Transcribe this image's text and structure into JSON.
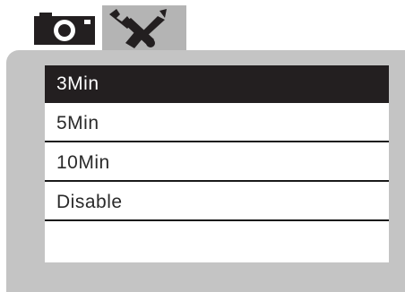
{
  "tabs": [
    {
      "icon": "camera-icon",
      "active": false
    },
    {
      "icon": "wrench-screwdriver-icon",
      "active": true
    }
  ],
  "menu": {
    "items": [
      {
        "label": "3Min",
        "selected": true
      },
      {
        "label": "5Min",
        "selected": false
      },
      {
        "label": "10Min",
        "selected": false
      },
      {
        "label": "Disable",
        "selected": false
      }
    ]
  },
  "colors": {
    "panel": "#c4c4c4",
    "active_tab": "#b4b4b4",
    "selected_row": "#231f20",
    "icon": "#231f20"
  }
}
